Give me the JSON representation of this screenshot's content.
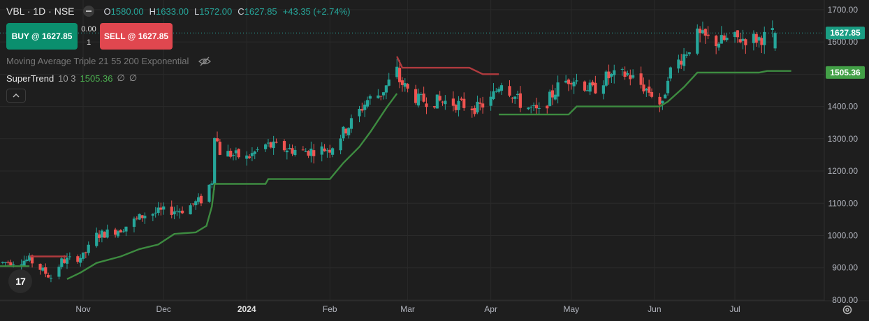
{
  "header": {
    "symbol": "VBL · 1D · NSE",
    "o_label": "O",
    "o_val": "1580.00",
    "h_label": "H",
    "h_val": "1633.00",
    "l_label": "L",
    "l_val": "1572.00",
    "c_label": "C",
    "c_val": "1627.85",
    "change": "+43.35 (+2.74%)"
  },
  "trade": {
    "buy_label": "BUY @ 1627.85",
    "sell_label": "SELL @ 1627.85",
    "spread": "0.00",
    "qty": "1"
  },
  "indicators": {
    "ma_label": "Moving Average Triple 21 55 200 Exponential",
    "st_name": "SuperTrend",
    "st_params": "10 3",
    "st_value": "1505.36",
    "st_null1": "∅",
    "st_null2": "∅"
  },
  "logo_text": "17",
  "colors": {
    "up": "#26a69a",
    "down": "#ef5350",
    "st_up": "#4caf50",
    "st_down": "#e53935",
    "grid": "#2a2a2a",
    "text": "#b2b5be"
  },
  "chart_data": {
    "type": "candlestick",
    "symbol": "VBL",
    "timeframe": "1D",
    "exchange": "NSE",
    "y_ticks": [
      800,
      900,
      1000,
      1100,
      1200,
      1300,
      1400,
      1500,
      1600,
      1700
    ],
    "y_tick_labels": [
      "800.00",
      "900.00",
      "1000.00",
      "1100.00",
      "1200.00",
      "1300.00",
      "1400.00",
      "1500.00",
      "1600.00",
      "1700.00"
    ],
    "ylim": [
      735,
      1730
    ],
    "x_ticks": [
      {
        "date": "2023-11-01",
        "label": "Nov"
      },
      {
        "date": "2023-12-01",
        "label": "Dec"
      },
      {
        "date": "2024-01-01",
        "label": "2024"
      },
      {
        "date": "2024-02-01",
        "label": "Feb"
      },
      {
        "date": "2024-03-01",
        "label": "Mar"
      },
      {
        "date": "2024-04-01",
        "label": "Apr"
      },
      {
        "date": "2024-05-01",
        "label": "May"
      },
      {
        "date": "2024-06-01",
        "label": "Jun"
      },
      {
        "date": "2024-07-01",
        "label": "Jul"
      }
    ],
    "xlim": [
      "2023-10-01",
      "2024-08-20"
    ],
    "price_anchors": [
      [
        "2023-10-01",
        915
      ],
      [
        "2023-10-12",
        925
      ],
      [
        "2023-10-20",
        870
      ],
      [
        "2023-10-24",
        920
      ],
      [
        "2023-11-01",
        935
      ],
      [
        "2023-11-06",
        1000
      ],
      [
        "2023-11-15",
        1020
      ],
      [
        "2023-11-24",
        1065
      ],
      [
        "2023-12-01",
        1075
      ],
      [
        "2023-12-08",
        1080
      ],
      [
        "2023-12-15",
        1110
      ],
      [
        "2023-12-19",
        1170
      ],
      [
        "2023-12-20",
        1320
      ],
      [
        "2023-12-22",
        1260
      ],
      [
        "2024-01-01",
        1240
      ],
      [
        "2024-01-08",
        1280
      ],
      [
        "2024-01-15",
        1270
      ],
      [
        "2024-01-22",
        1260
      ],
      [
        "2024-02-01",
        1270
      ],
      [
        "2024-02-08",
        1340
      ],
      [
        "2024-02-15",
        1420
      ],
      [
        "2024-02-20",
        1440
      ],
      [
        "2024-02-26",
        1510
      ],
      [
        "2024-02-27",
        1480
      ],
      [
        "2024-03-01",
        1450
      ],
      [
        "2024-03-05",
        1420
      ],
      [
        "2024-03-15",
        1415
      ],
      [
        "2024-03-27",
        1395
      ],
      [
        "2024-04-01",
        1420
      ],
      [
        "2024-04-05",
        1480
      ],
      [
        "2024-04-12",
        1410
      ],
      [
        "2024-04-19",
        1380
      ],
      [
        "2024-04-26",
        1460
      ],
      [
        "2024-05-01",
        1490
      ],
      [
        "2024-05-09",
        1450
      ],
      [
        "2024-05-14",
        1490
      ],
      [
        "2024-05-22",
        1500
      ],
      [
        "2024-05-31",
        1440
      ],
      [
        "2024-06-04",
        1400
      ],
      [
        "2024-06-06",
        1500
      ],
      [
        "2024-06-12",
        1560
      ],
      [
        "2024-06-17",
        1620
      ],
      [
        "2024-06-24",
        1600
      ],
      [
        "2024-07-01",
        1610
      ],
      [
        "2024-07-10",
        1610
      ],
      [
        "2024-07-16",
        1627.85
      ]
    ],
    "last_candle": {
      "date": "2024-07-16",
      "open": 1580.0,
      "high": 1633.0,
      "low": 1572.0,
      "close": 1627.85
    },
    "supertrend": {
      "params": "10 3",
      "last_value": 1505.36,
      "segments": [
        {
          "trend": "up",
          "points": [
            [
              "2023-10-01",
              905
            ],
            [
              "2023-10-12",
              905
            ]
          ]
        },
        {
          "trend": "down",
          "points": [
            [
              "2023-10-12",
              935
            ],
            [
              "2023-10-26",
              935
            ]
          ]
        },
        {
          "trend": "up",
          "points": [
            [
              "2023-10-26",
              865
            ],
            [
              "2023-10-31",
              885
            ],
            [
              "2023-11-06",
              915
            ],
            [
              "2023-11-15",
              935
            ],
            [
              "2023-11-22",
              958
            ],
            [
              "2023-11-29",
              972
            ],
            [
              "2023-12-05",
              1005
            ],
            [
              "2023-12-13",
              1010
            ],
            [
              "2023-12-17",
              1030
            ],
            [
              "2023-12-19",
              1090
            ],
            [
              "2023-12-20",
              1160
            ],
            [
              "2024-01-08",
              1160
            ],
            [
              "2024-01-09",
              1175
            ],
            [
              "2024-02-01",
              1175
            ],
            [
              "2024-02-06",
              1225
            ],
            [
              "2024-02-12",
              1275
            ],
            [
              "2024-02-16",
              1320
            ],
            [
              "2024-02-22",
              1395
            ],
            [
              "2024-02-26",
              1440
            ]
          ]
        },
        {
          "trend": "down",
          "points": [
            [
              "2024-02-26",
              1555
            ],
            [
              "2024-02-28",
              1520
            ],
            [
              "2024-03-24",
              1520
            ],
            [
              "2024-03-29",
              1500
            ],
            [
              "2024-04-04",
              1500
            ]
          ]
        },
        {
          "trend": "up",
          "points": [
            [
              "2024-04-04",
              1375
            ],
            [
              "2024-04-30",
              1375
            ],
            [
              "2024-05-03",
              1400
            ],
            [
              "2024-06-03",
              1400
            ],
            [
              "2024-06-06",
              1415
            ],
            [
              "2024-06-12",
              1460
            ],
            [
              "2024-06-17",
              1505
            ],
            [
              "2024-07-10",
              1505
            ],
            [
              "2024-07-13",
              1510
            ],
            [
              "2024-07-22",
              1510
            ]
          ]
        }
      ]
    },
    "last_price_label": "1627.85",
    "supertrend_label": "1505.36"
  }
}
